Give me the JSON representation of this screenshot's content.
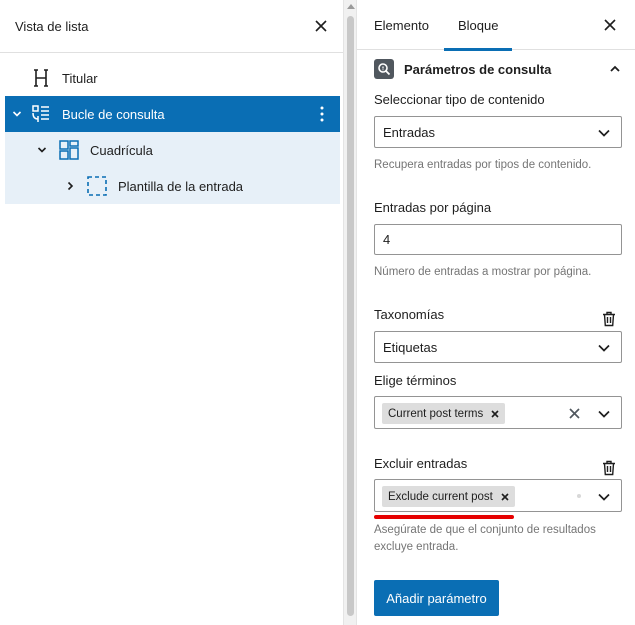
{
  "list_view": {
    "title": "Vista de lista",
    "items": [
      {
        "label": "Titular",
        "icon": "heading-icon"
      },
      {
        "label": "Bucle de consulta",
        "icon": "query-loop-icon"
      },
      {
        "label": "Cuadrícula",
        "icon": "grid-icon"
      },
      {
        "label": "Plantilla de la entrada",
        "icon": "post-template-icon"
      }
    ]
  },
  "sidebar": {
    "tabs": [
      {
        "label": "Elemento"
      },
      {
        "label": "Bloque"
      }
    ],
    "panel": {
      "title": "Parámetros de consulta"
    },
    "content_type": {
      "label": "Seleccionar tipo de contenido",
      "value": "Entradas",
      "help": "Recupera entradas por tipos de contenido."
    },
    "per_page": {
      "label": "Entradas por página",
      "value": "4",
      "help": "Número de entradas a mostrar por página."
    },
    "taxonomies": {
      "label": "Taxonomías",
      "value": "Etiquetas"
    },
    "terms": {
      "label": "Elige términos",
      "token": "Current post terms"
    },
    "exclude": {
      "label": "Excluir entradas",
      "token": "Exclude current post",
      "help": "Asegúrate de que el conjunto de resultados excluye entrada."
    },
    "add_button": "Añadir parámetro"
  },
  "colors": {
    "accent": "#0a6eb4",
    "selected_child_bg": "#e7f0f8",
    "annotation": "#e60000"
  }
}
